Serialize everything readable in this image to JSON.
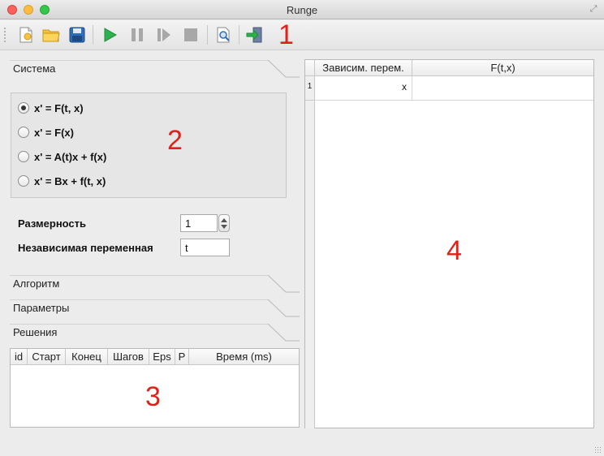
{
  "window": {
    "title": "Runge"
  },
  "toolbar": {
    "buttons": [
      {
        "name": "new-document-icon"
      },
      {
        "name": "open-folder-icon"
      },
      {
        "name": "save-floppy-icon"
      },
      {
        "name": "run-play-icon"
      },
      {
        "name": "pause-icon"
      },
      {
        "name": "step-forward-icon"
      },
      {
        "name": "stop-icon"
      },
      {
        "name": "preview-icon"
      },
      {
        "name": "exit-icon"
      }
    ],
    "annotation": "1"
  },
  "system_panel": {
    "title": "Система",
    "options": [
      {
        "label": "x' = F(t, x)",
        "checked": true
      },
      {
        "label": "x' = F(x)",
        "checked": false
      },
      {
        "label": "x' = A(t)x + f(x)",
        "checked": false
      },
      {
        "label": "x' = Bx + f(t, x)",
        "checked": false
      }
    ],
    "annotation": "2",
    "dimension_label": "Размерность",
    "dimension_value": "1",
    "independent_var_label": "Независимая переменная",
    "independent_var_value": "t"
  },
  "collapsed_panels": {
    "algorithm": "Алгоритм",
    "parameters": "Параметры",
    "solutions": "Решения"
  },
  "solutions_table": {
    "columns": [
      "id",
      "Старт",
      "Конец",
      "Шагов",
      "Eps",
      "P",
      "Время (ms)"
    ],
    "rows": [],
    "annotation": "3"
  },
  "equations_table": {
    "columns": [
      "Зависим. перем.",
      "F(t,x)"
    ],
    "rows": [
      {
        "index": "1",
        "dep_var": "x",
        "func": ""
      }
    ],
    "annotation": "4"
  },
  "colors": {
    "annotation": "#e0201b",
    "run_green": "#2bb24c",
    "disabled_gray": "#a8a8a8"
  }
}
